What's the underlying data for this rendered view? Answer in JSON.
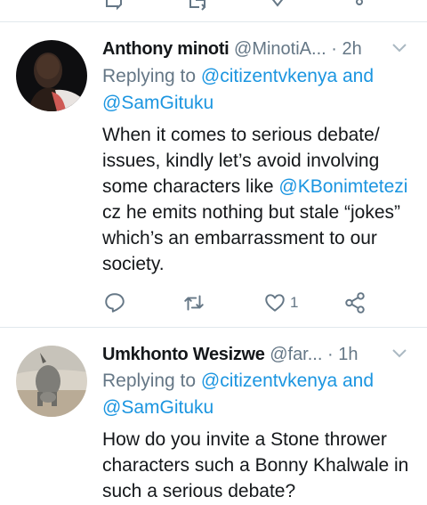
{
  "colors": {
    "link": "#1b95e0",
    "muted": "#657786",
    "text": "#14171a",
    "divider": "#e1e8ed"
  },
  "tweets": [
    {
      "display_name": "Anthony minoti",
      "handle": "@MinotiA...",
      "sep": " · ",
      "time": "2h",
      "replying_prefix": "Replying to ",
      "replying_user1": "@citizentvkenya",
      "replying_and": " and",
      "replying_user2": "@SamGituku",
      "text_part1": "When it comes to serious debate/ issues, kindly let’s avoid involving some characters like ",
      "mention": "@KBonimtetezi",
      "text_part2": " cz he emits nothing but stale “jokes” which’s an embarrassment to our society.",
      "like_count": "1"
    },
    {
      "display_name": "Umkhonto Wesizwe",
      "handle": "@far...",
      "sep": " · ",
      "time": "1h",
      "replying_prefix": "Replying to ",
      "replying_user1": "@citizentvkenya",
      "replying_and": " and",
      "replying_user2": "@SamGituku",
      "text": "How do you invite a Stone thrower characters such a Bonny Khalwale in such a serious debate?"
    }
  ],
  "icons": [
    "reply-icon",
    "retweet-icon",
    "like-icon",
    "share-icon",
    "chevron-down-icon"
  ]
}
